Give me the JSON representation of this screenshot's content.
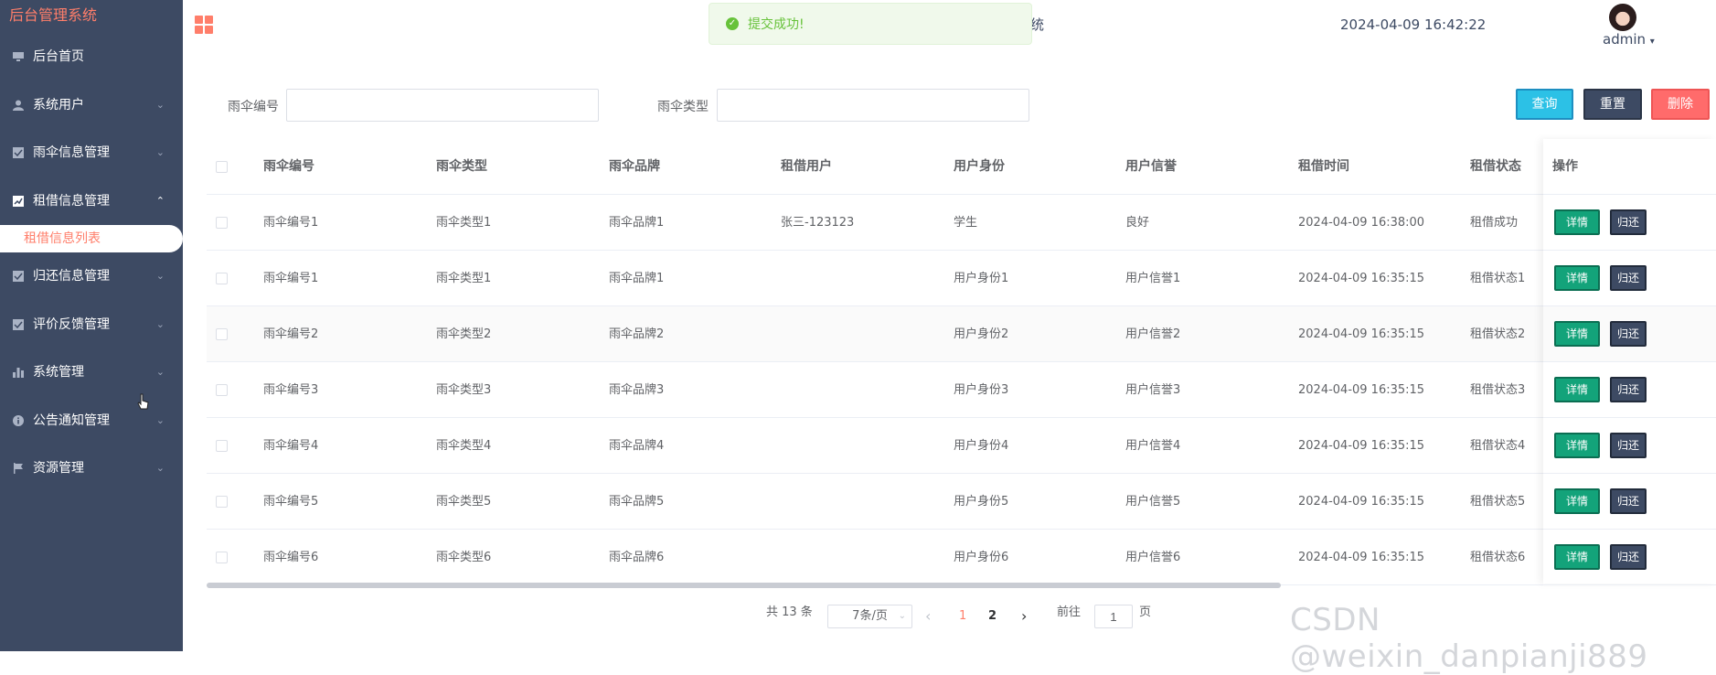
{
  "sidebar": {
    "brand": "后台管理系统",
    "items": [
      {
        "label": "后台首页",
        "icon": "monitor-icon",
        "chevron": ""
      },
      {
        "label": "系统用户",
        "icon": "user-icon",
        "chevron": "⌄"
      },
      {
        "label": "雨伞信息管理",
        "icon": "checkbox-icon",
        "chevron": "⌄"
      },
      {
        "label": "租借信息管理",
        "icon": "trend-icon",
        "chevron": "⌃"
      },
      {
        "label": "归还信息管理",
        "icon": "checkbox-icon",
        "chevron": "⌄"
      },
      {
        "label": "评价反馈管理",
        "icon": "checkbox-icon",
        "chevron": "⌄"
      },
      {
        "label": "系统管理",
        "icon": "bar-chart-icon",
        "chevron": "⌄"
      },
      {
        "label": "公告通知管理",
        "icon": "info-icon",
        "chevron": "⌄"
      },
      {
        "label": "资源管理",
        "icon": "flag-icon",
        "chevron": "⌄"
      }
    ],
    "submenu_active": "租借信息列表"
  },
  "header": {
    "title_fragment": "统",
    "datetime": "2024-04-09 16:42:22",
    "username": "admin"
  },
  "toast": {
    "message": "提交成功!"
  },
  "filters": {
    "umbrella_no_label": "雨伞编号",
    "umbrella_no_value": "",
    "umbrella_type_label": "雨伞类型",
    "umbrella_type_value": "",
    "query": "查询",
    "reset": "重置",
    "delete": "删除"
  },
  "table": {
    "headers": [
      "雨伞编号",
      "雨伞类型",
      "雨伞品牌",
      "租借用户",
      "用户身份",
      "用户信誉",
      "租借时间",
      "租借状态"
    ],
    "ops_header": "操作",
    "detail_label": "详情",
    "return_label": "归还",
    "rows": [
      [
        "雨伞编号1",
        "雨伞类型1",
        "雨伞品牌1",
        "张三-123123",
        "学生",
        "良好",
        "2024-04-09 16:38:00",
        "租借成功"
      ],
      [
        "雨伞编号1",
        "雨伞类型1",
        "雨伞品牌1",
        "",
        "用户身份1",
        "用户信誉1",
        "2024-04-09 16:35:15",
        "租借状态1"
      ],
      [
        "雨伞编号2",
        "雨伞类型2",
        "雨伞品牌2",
        "",
        "用户身份2",
        "用户信誉2",
        "2024-04-09 16:35:15",
        "租借状态2"
      ],
      [
        "雨伞编号3",
        "雨伞类型3",
        "雨伞品牌3",
        "",
        "用户身份3",
        "用户信誉3",
        "2024-04-09 16:35:15",
        "租借状态3"
      ],
      [
        "雨伞编号4",
        "雨伞类型4",
        "雨伞品牌4",
        "",
        "用户身份4",
        "用户信誉4",
        "2024-04-09 16:35:15",
        "租借状态4"
      ],
      [
        "雨伞编号5",
        "雨伞类型5",
        "雨伞品牌5",
        "",
        "用户身份5",
        "用户信誉5",
        "2024-04-09 16:35:15",
        "租借状态5"
      ],
      [
        "雨伞编号6",
        "雨伞类型6",
        "雨伞品牌6",
        "",
        "用户身份6",
        "用户信誉6",
        "2024-04-09 16:35:15",
        "租借状态6"
      ]
    ]
  },
  "pagination": {
    "total": "共 13 条",
    "page_size": "7条/页",
    "prev": "‹",
    "pages": [
      "1",
      "2"
    ],
    "current": "1",
    "next": "›",
    "goto_label": "前往",
    "goto_value": "1",
    "page_suffix": "页"
  },
  "watermark": "CSDN @weixin_danpianji889",
  "colors": {
    "sidebar": "#3d4a63",
    "accent": "#ff7e6a",
    "success": "#67c23a",
    "query": "#2cc1e6",
    "detail": "#13a37a",
    "delete": "#ff6b6b"
  }
}
